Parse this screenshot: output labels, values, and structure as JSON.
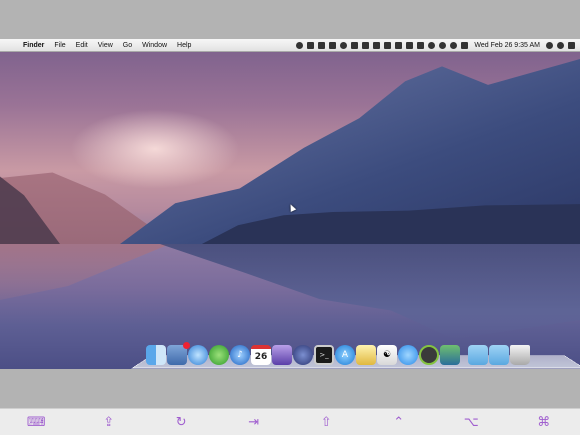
{
  "menubar": {
    "apple_glyph": "",
    "app_name": "Finder",
    "menus": [
      "File",
      "Edit",
      "View",
      "Go",
      "Window",
      "Help"
    ],
    "clock": "Wed Feb 26  9:35 AM"
  },
  "dock": {
    "calendar_day": "26",
    "items": [
      "finder",
      "mail-stamp",
      "safari",
      "adium",
      "itunes",
      "calendar",
      "dashboard",
      "quicksilver",
      "terminal",
      "app-store",
      "script-editor",
      "tv-remote",
      "messages",
      "spotify",
      "screen-sharing",
      "applications-folder",
      "downloads-folder",
      "trash"
    ]
  },
  "toolbar": {
    "keyboard": "⌨",
    "share": "⇪",
    "rotate": "↻",
    "tab": "⇥",
    "shift": "⇧",
    "control": "⌃",
    "option": "⌥",
    "command": "⌘"
  },
  "colors": {
    "toolbar_accent": "#a05fcf"
  }
}
